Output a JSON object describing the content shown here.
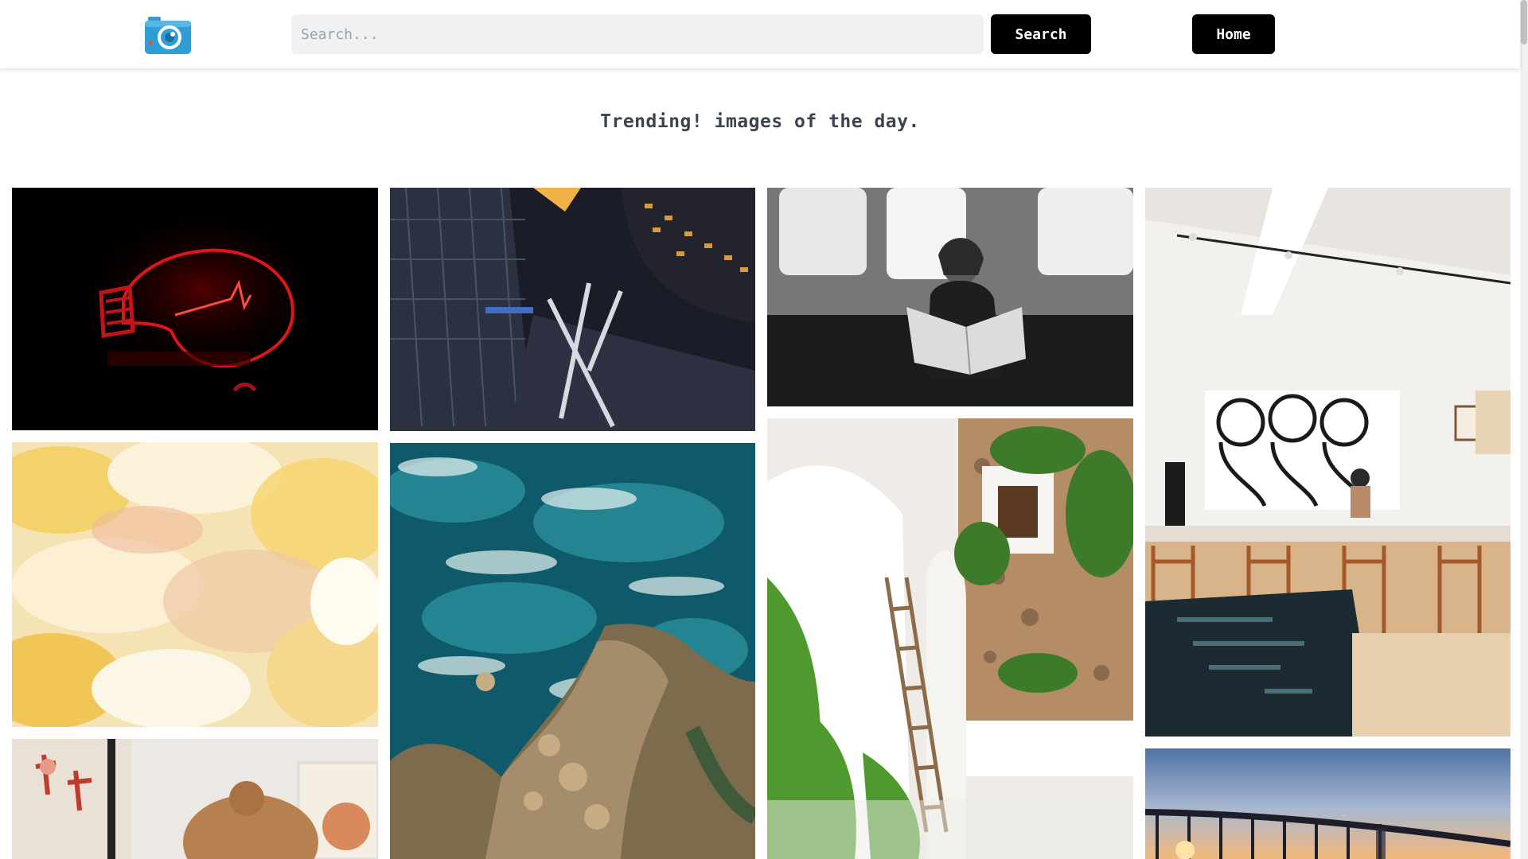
{
  "header": {
    "logo_icon": "camera-icon",
    "search_placeholder": "Search...",
    "search_value": "",
    "search_label": "Search",
    "home_label": "Home"
  },
  "main": {
    "title": "Trending! images of the day."
  },
  "colors": {
    "button_bg": "#000000",
    "input_bg": "#f0f1f3",
    "logo_blue": "#2f9ed6"
  },
  "gallery": [
    {
      "subject": "red glowing lightbulb on black background"
    },
    {
      "subject": "aerial night city street between tall buildings"
    },
    {
      "subject": "woman reading newspaper by window, black and white"
    },
    {
      "subject": "white cafe interior with painting of three figures"
    },
    {
      "subject": "yellow abstract paint strokes"
    },
    {
      "subject": "aerial view of turquoise ocean waves and rocky coast"
    },
    {
      "subject": "white wall with stone window, plants and ladder"
    },
    {
      "subject": "woman with hair bun in front of framed art"
    },
    {
      "subject": "pier silhouette at sunset"
    }
  ]
}
